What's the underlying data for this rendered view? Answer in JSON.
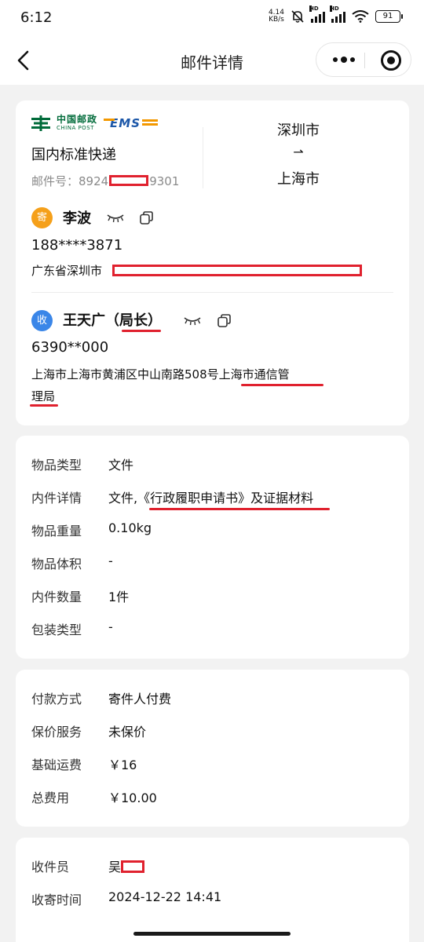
{
  "status_bar": {
    "time": "6:12",
    "net_speed_value": "4.14",
    "net_speed_unit": "KB/s",
    "sim1_tag": "HD",
    "sim2_tag": "HD",
    "battery": "91"
  },
  "nav": {
    "title": "邮件详情"
  },
  "shipment": {
    "carrier_cn": "中国邮政",
    "carrier_en": "CHINA POST",
    "brand": "EMS",
    "service": "国内标准快递",
    "mail_no_label": "邮件号：",
    "mail_no_prefix": "8924",
    "mail_no_suffix": "9301",
    "from_city": "深圳市",
    "route_arrow": "⇀",
    "to_city": "上海市"
  },
  "sender": {
    "badge": "寄",
    "name": "李波",
    "phone": "188****3871",
    "address": "广东省深圳市"
  },
  "receiver": {
    "badge": "收",
    "name": "王天广（局长）",
    "phone": "6390**000",
    "address_line1": "上海市上海市黄浦区中山南路508号上海市通信管",
    "address_line2": "理局"
  },
  "item_info": {
    "rows": [
      {
        "label": "物品类型",
        "value": "文件"
      },
      {
        "label": "内件详情",
        "value": "文件,《行政履职申请书》及证据材料"
      },
      {
        "label": "物品重量",
        "value": "0.10kg"
      },
      {
        "label": "物品体积",
        "value": "-"
      },
      {
        "label": "内件数量",
        "value": "1件"
      },
      {
        "label": "包装类型",
        "value": "-"
      }
    ]
  },
  "payment_info": {
    "rows": [
      {
        "label": "付款方式",
        "value": "寄件人付费"
      },
      {
        "label": "保价服务",
        "value": "未保价"
      },
      {
        "label": "基础运费",
        "value": "￥16"
      },
      {
        "label": "总费用",
        "value": "￥10.00"
      }
    ]
  },
  "collection_info": {
    "rows": [
      {
        "label": "收件员",
        "value": "吴"
      },
      {
        "label": "收寄时间",
        "value": "2024-12-22 14:41"
      }
    ]
  },
  "colors": {
    "redaction": "#e0212e",
    "sender_badge": "#f5a01a",
    "receiver_badge": "#3a86e8",
    "china_post_green": "#006b3a",
    "ems_blue": "#1c57a8"
  }
}
